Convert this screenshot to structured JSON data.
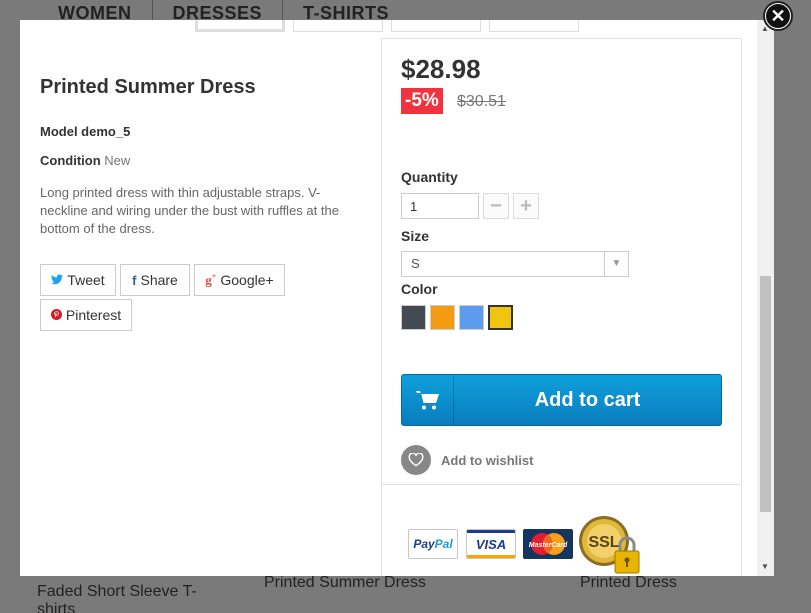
{
  "background": {
    "nav": [
      "WOMEN",
      "DRESSES",
      "T-SHIRTS"
    ],
    "products": [
      "Faded Short Sleeve T-shirts",
      "Printed Summer Dress",
      "Printed Dress"
    ]
  },
  "product": {
    "title": "Printed Summer Dress",
    "model": "Model demo_5",
    "condition_label": "Condition",
    "condition_value": "New",
    "description": "Long printed dress with thin adjustable straps. V-neckline and wiring under the bust with ruffles at the bottom of the dress."
  },
  "social": {
    "tweet": "Tweet",
    "share": "Share",
    "google": "Google+",
    "pinterest": "Pinterest"
  },
  "pricing": {
    "price": "$28.98",
    "discount": "-5%",
    "old_price": "$30.51"
  },
  "options": {
    "quantity_label": "Quantity",
    "quantity_value": "1",
    "size_label": "Size",
    "size_value": "S",
    "color_label": "Color",
    "colors": [
      "#434a54",
      "#f39c11",
      "#5d9cec",
      "#f1c40f"
    ],
    "selected_color_index": 3
  },
  "actions": {
    "add_to_cart": "Add to cart",
    "add_to_wishlist": "Add to wishlist"
  },
  "payments": {
    "paypal_a": "Pay",
    "paypal_b": "Pal",
    "visa": "VISA",
    "mastercard": "MasterCard",
    "ssl": "SSL"
  },
  "accent_colors": {
    "cart": "#0a8fd1",
    "discount": "#f13340"
  }
}
